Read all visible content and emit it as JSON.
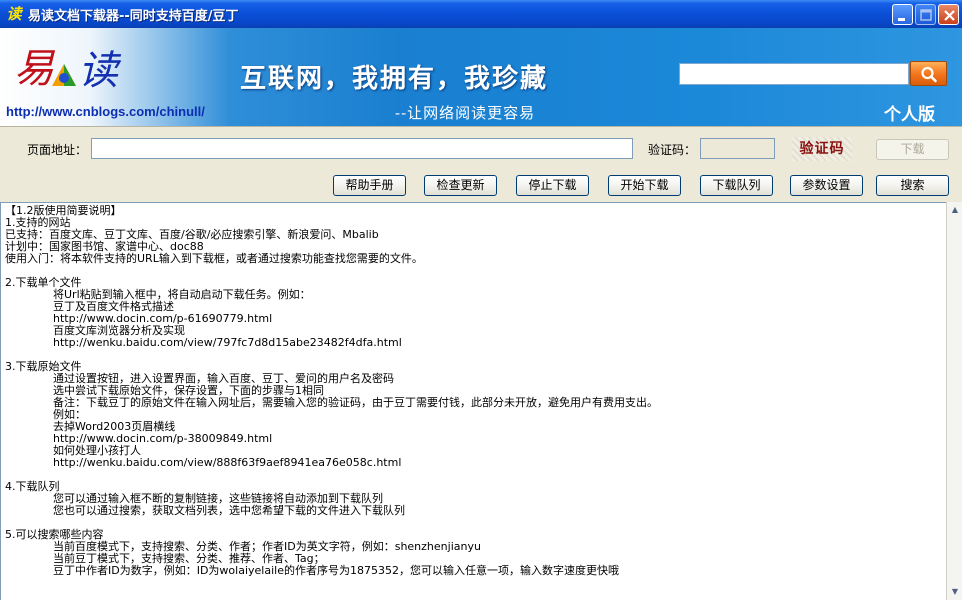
{
  "window": {
    "title": "易读文档下载器--同时支持百度/豆丁",
    "app_icon_glyph": "读"
  },
  "banner": {
    "url": "http://www.cnblogs.com/chinull/",
    "slogan": "互联网，我拥有，我珍藏",
    "subslogan": "--让网络阅读更容易",
    "edition": "个人版",
    "search_placeholder": ""
  },
  "form": {
    "url_label": "页面地址：",
    "url_value": "",
    "captcha_label": "验证码：",
    "captcha_value": "",
    "captcha_image_text": "验证码",
    "download_label": "下载"
  },
  "toolbar": {
    "help": "帮助手册",
    "check_update": "检查更新",
    "stop_download": "停止下载",
    "start_download": "开始下载",
    "download_queue": "下载队列",
    "settings": "参数设置",
    "search": "搜索"
  },
  "content": {
    "lines": [
      {
        "text": "【1.2版使用简要说明】",
        "indent": false
      },
      {
        "text": "1.支持的网站",
        "indent": false
      },
      {
        "text": "已支持：百度文库、豆丁文库、百度/谷歌/必应搜索引擎、新浪爱问、Mbalib",
        "indent": false
      },
      {
        "text": "计划中：国家图书馆、家谱中心、doc88",
        "indent": false
      },
      {
        "text": "使用入门：将本软件支持的URL输入到下载框，或者通过搜索功能查找您需要的文件。",
        "indent": false
      },
      {
        "text": "",
        "indent": false
      },
      {
        "text": "2.下载单个文件",
        "indent": false
      },
      {
        "text": "将Url粘贴到输入框中，将自动启动下载任务。例如：",
        "indent": true
      },
      {
        "text": "豆丁及百度文件格式描述",
        "indent": true
      },
      {
        "text": "http://www.docin.com/p-61690779.html",
        "indent": true
      },
      {
        "text": "百度文库浏览器分析及实现",
        "indent": true
      },
      {
        "text": "http://wenku.baidu.com/view/797fc7d8d15abe23482f4dfa.html",
        "indent": true
      },
      {
        "text": "",
        "indent": false
      },
      {
        "text": "3.下载原始文件",
        "indent": false
      },
      {
        "text": "通过设置按钮，进入设置界面，输入百度、豆丁、爱问的用户名及密码",
        "indent": true
      },
      {
        "text": "选中尝试下载原始文件，保存设置，下面的步骤与1相同",
        "indent": true
      },
      {
        "text": "备注：下载豆丁的原始文件在输入网址后，需要输入您的验证码，由于豆丁需要付钱，此部分未开放，避免用户有费用支出。",
        "indent": true
      },
      {
        "text": "例如：",
        "indent": true
      },
      {
        "text": "去掉Word2003页眉横线",
        "indent": true
      },
      {
        "text": "http://www.docin.com/p-38009849.html",
        "indent": true
      },
      {
        "text": "如何处理小孩打人",
        "indent": true
      },
      {
        "text": "http://wenku.baidu.com/view/888f63f9aef8941ea76e058c.html",
        "indent": true
      },
      {
        "text": "",
        "indent": false
      },
      {
        "text": "4.下载队列",
        "indent": false
      },
      {
        "text": "您可以通过输入框不断的复制链接，这些链接将自动添加到下载队列",
        "indent": true
      },
      {
        "text": "您也可以通过搜索，获取文档列表，选中您希望下载的文件进入下载队列",
        "indent": true
      },
      {
        "text": "",
        "indent": false
      },
      {
        "text": "5.可以搜索哪些内容",
        "indent": false
      },
      {
        "text": "当前百度模式下，支持搜索、分类、作者；作者ID为英文字符，例如：shenzhenjianyu",
        "indent": true
      },
      {
        "text": "当前豆丁模式下，支持搜索、分类、推荐、作者、Tag；",
        "indent": true
      },
      {
        "text": "豆丁中作者ID为数字，例如：ID为wolaiyelaile的作者序号为1875352，您可以输入任意一项，输入数字速度更快哦",
        "indent": true
      }
    ]
  },
  "colors": {
    "titlebar": "#0a4fd6",
    "banner_blue": "#1a7fd0",
    "search_button": "#f2731a",
    "url_link": "#0b2fb0"
  }
}
